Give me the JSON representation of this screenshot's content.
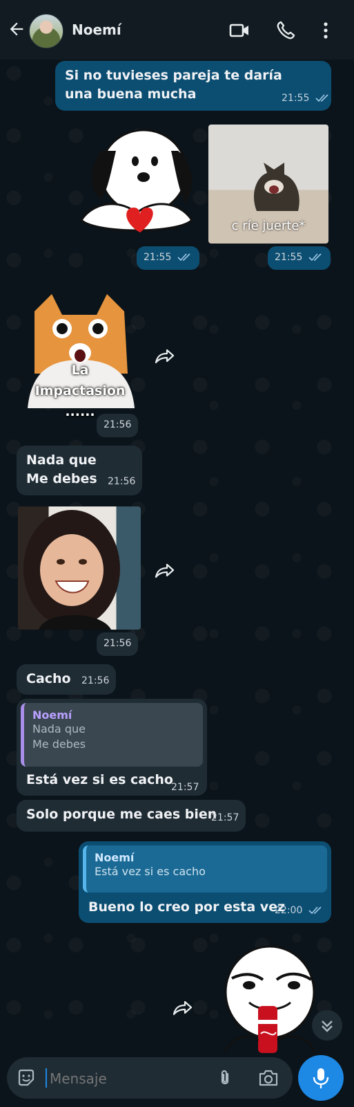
{
  "header": {
    "contact_name": "Noemí"
  },
  "messages": {
    "m1": {
      "text": "Si no tuvieses pareja te daría una buena mucha",
      "time": "21:55"
    },
    "sticker_snoopy": {
      "time": "21:55"
    },
    "photo_cat": {
      "caption": "c ríe juerte*",
      "time": "21:55"
    },
    "sticker_cat": {
      "text_line1": "La",
      "text_line2": "Impactasion ......",
      "time": "21:56"
    },
    "m_nada": {
      "line1": "Nada que",
      "line2": "Me debes",
      "time": "21:56"
    },
    "photo_girl": {
      "time": "21:56"
    },
    "m_cacho": {
      "text": "Cacho",
      "time": "21:56"
    },
    "m_reply1": {
      "quote_name": "Noemí",
      "quote_line1": "Nada que",
      "quote_line2": "Me debes",
      "text": "Está vez si es cacho",
      "time": "21:57"
    },
    "m_solo": {
      "text": "Solo porque me caes bien",
      "time": "21:57"
    },
    "m_reply2": {
      "quote_name": "Noemí",
      "quote_text": "Está vez si es cacho",
      "text": "Bueno lo creo por esta vez",
      "time": "22:00"
    }
  },
  "input": {
    "placeholder": "Mensaje"
  },
  "colors": {
    "outgoing": "#0c4e72",
    "incoming": "#1f2c34",
    "accent": "#1e88e5",
    "background": "#0b141a"
  }
}
